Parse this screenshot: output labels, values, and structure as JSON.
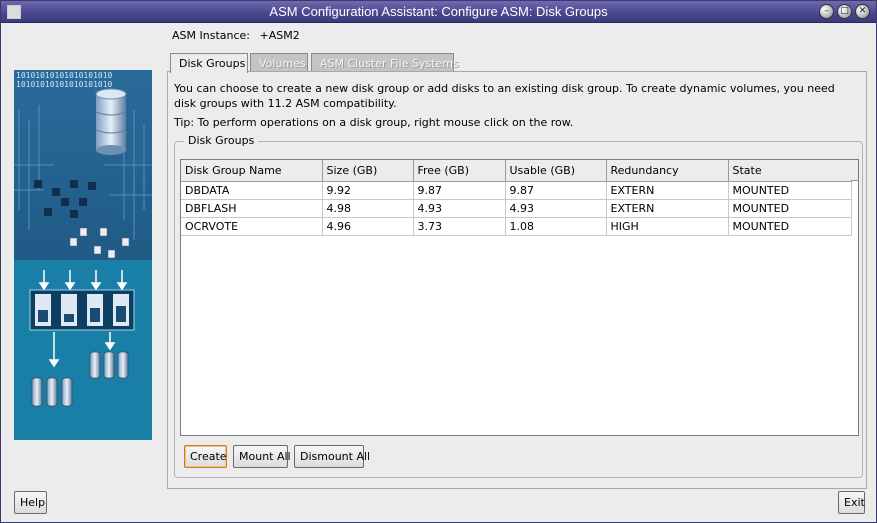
{
  "window": {
    "title": "ASM Configuration Assistant: Configure ASM: Disk Groups"
  },
  "header": {
    "instance_label": "ASM Instance:",
    "instance_value": "+ASM2"
  },
  "tabs": [
    {
      "label": "Disk Groups",
      "active": true
    },
    {
      "label": "Volumes",
      "active": false
    },
    {
      "label": "ASM Cluster File Systems",
      "active": false
    }
  ],
  "description": "You can choose to create a new disk group or add disks to an existing disk group. To create dynamic volumes, you need disk groups with 11.2 ASM compatibility.",
  "tip": "Tip: To perform operations on a disk group, right mouse click on the row.",
  "disk_groups": {
    "legend": "Disk Groups",
    "columns": [
      "Disk Group Name",
      "Size (GB)",
      "Free (GB)",
      "Usable (GB)",
      "Redundancy",
      "State"
    ],
    "rows": [
      [
        "DBDATA",
        "9.92",
        "9.87",
        "9.87",
        "EXTERN",
        "MOUNTED"
      ],
      [
        "DBFLASH",
        "4.98",
        "4.93",
        "4.93",
        "EXTERN",
        "MOUNTED"
      ],
      [
        "OCRVOTE",
        "4.96",
        "3.73",
        "1.08",
        "HIGH",
        "MOUNTED"
      ]
    ]
  },
  "buttons": {
    "create": "Create",
    "mount_all": "Mount All",
    "dismount_all": "Dismount All",
    "help": "Help",
    "exit": "Exit"
  },
  "art": {
    "binary_text": "10101010101010101010"
  }
}
